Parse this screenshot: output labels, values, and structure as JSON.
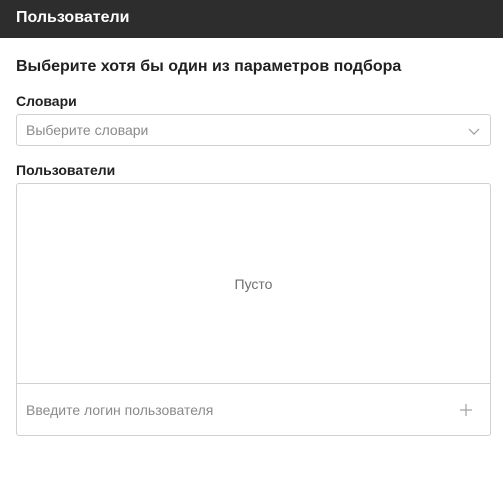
{
  "header": {
    "title": "Пользователи"
  },
  "form": {
    "title": "Выберите хотя бы один из параметров подбора",
    "dictionaries": {
      "label": "Словари",
      "placeholder": "Выберите словари",
      "icon": "chevron-down-icon"
    },
    "users": {
      "label": "Пользователи",
      "empty_text": "Пусто",
      "input_placeholder": "Введите логин пользователя",
      "add_icon": "plus-icon"
    }
  },
  "colors": {
    "header_bg": "#2d2d2d",
    "border": "#d0d0d0",
    "placeholder": "#8a8a8a"
  }
}
